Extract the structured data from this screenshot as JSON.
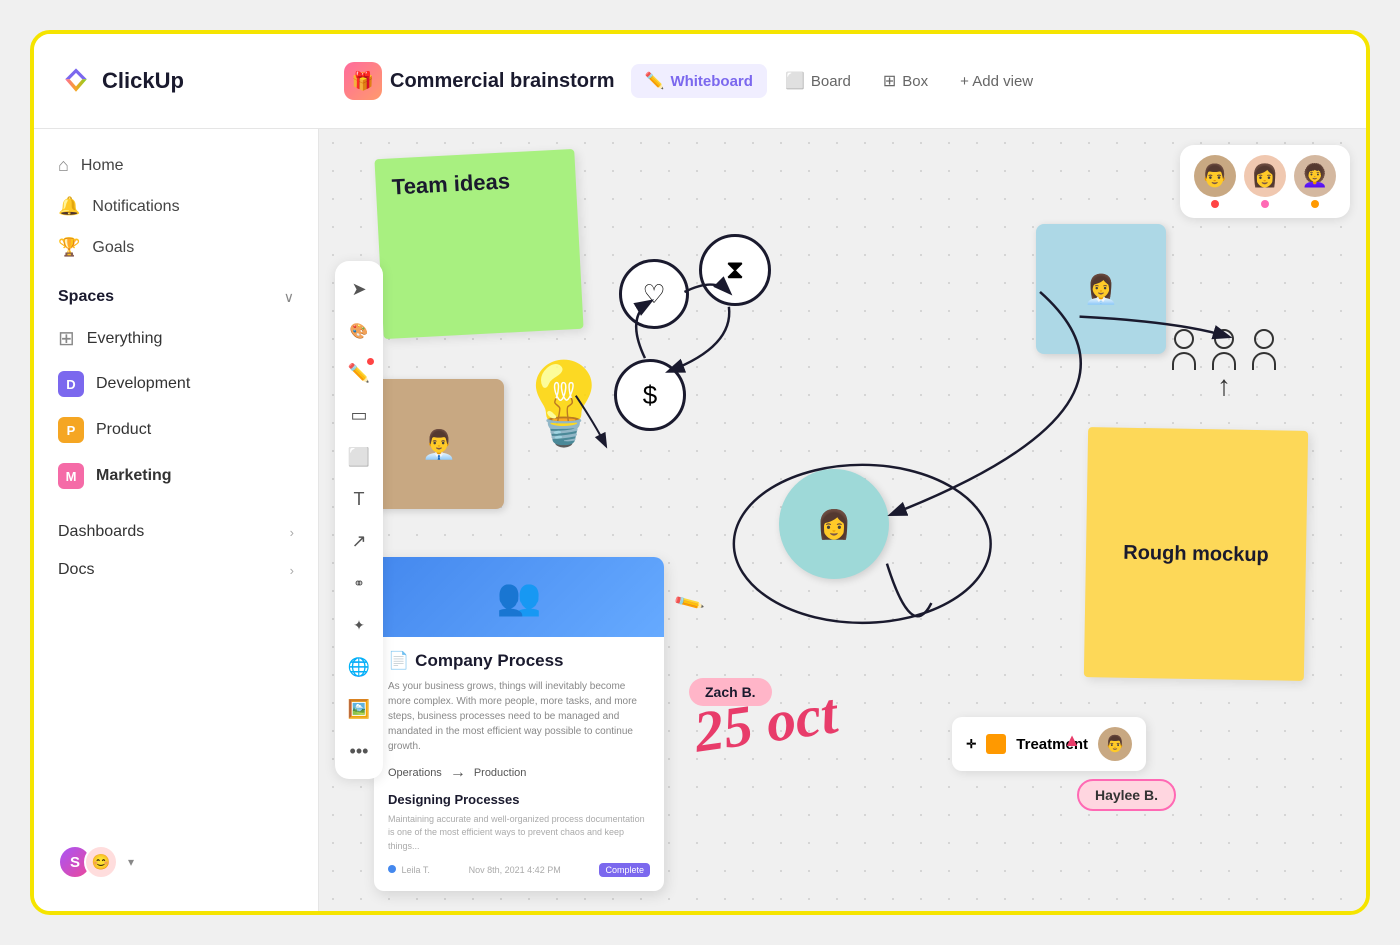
{
  "app": {
    "name": "ClickUp"
  },
  "topbar": {
    "space_icon": "🎁",
    "breadcrumb": "Commercial brainstorm",
    "tabs": [
      {
        "id": "whiteboard",
        "label": "Whiteboard",
        "icon": "✏️",
        "active": true
      },
      {
        "id": "board",
        "label": "Board",
        "icon": "⬜",
        "active": false
      },
      {
        "id": "box",
        "label": "Box",
        "icon": "⊞",
        "active": false
      }
    ],
    "add_view_label": "+ Add view"
  },
  "sidebar": {
    "nav_items": [
      {
        "id": "home",
        "label": "Home",
        "icon": "⌂"
      },
      {
        "id": "notifications",
        "label": "Notifications",
        "icon": "🔔"
      },
      {
        "id": "goals",
        "label": "Goals",
        "icon": "🏆"
      }
    ],
    "spaces_title": "Spaces",
    "spaces": [
      {
        "id": "everything",
        "label": "Everything",
        "badge": null
      },
      {
        "id": "development",
        "label": "Development",
        "badge": "D",
        "color": "purple"
      },
      {
        "id": "product",
        "label": "Product",
        "badge": "P",
        "color": "orange"
      },
      {
        "id": "marketing",
        "label": "Marketing",
        "badge": "M",
        "color": "pink"
      }
    ],
    "dashboards_label": "Dashboards",
    "docs_label": "Docs"
  },
  "whiteboard": {
    "sticky_green": "Team ideas",
    "sticky_yellow": "Rough mockup",
    "doc_card": {
      "title": "Company Process",
      "text": "As your business grows, things will inevitably become more complex. With more people, more tasks, and more steps, business processes need to be managed and mandated in the most efficient way possible to continue growth.",
      "arrow_from": "Operations",
      "arrow_to": "Production",
      "section_title": "Designing Processes",
      "sub_text": "Maintaining accurate and well-organized process documentation is one of the most efficient ways to prevent chaos and keep things...",
      "footer_author": "Leila T.",
      "footer_date": "Nov 8th, 2021 4:42 PM",
      "footer_status": "Complete"
    },
    "handwritten_date": "25 oct",
    "name_badges": [
      {
        "id": "zach",
        "label": "Zach B.",
        "style": "pink"
      },
      {
        "id": "haylee",
        "label": "Haylee B.",
        "style": "pink-outline"
      }
    ],
    "treatment_card": {
      "label": "Treatment",
      "icon": "■"
    },
    "collab_avatars": [
      {
        "id": "av1",
        "dot": "red"
      },
      {
        "id": "av2",
        "dot": "pink"
      },
      {
        "id": "av3",
        "dot": "orange"
      }
    ]
  }
}
